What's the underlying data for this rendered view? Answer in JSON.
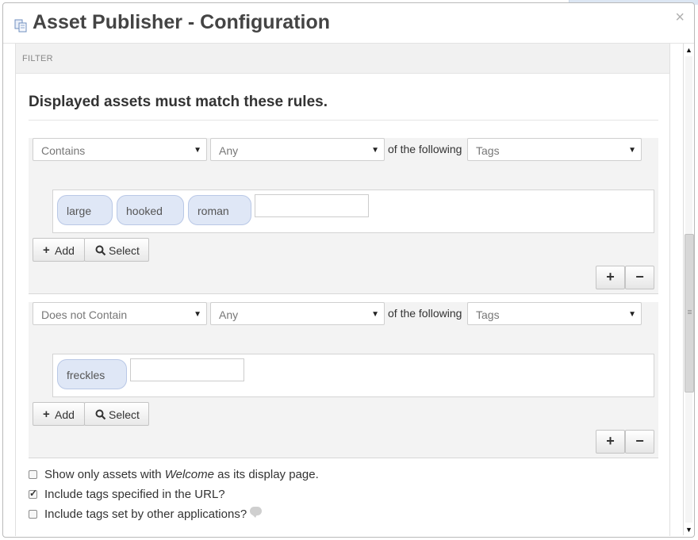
{
  "dialog": {
    "title": "Asset Publisher - Configuration",
    "close_symbol": "×",
    "icon": "document-pages-icon"
  },
  "filter": {
    "panel_label": "FILTER",
    "heading": "Displayed assets must match these rules."
  },
  "rules": [
    {
      "operator": "Contains",
      "match": "Any",
      "connector": "of the following",
      "type": "Tags",
      "tags": [
        "large",
        "hooked",
        "roman"
      ],
      "add_label": "Add",
      "select_label": "Select",
      "plus_symbol": "+",
      "minus_symbol": "−"
    },
    {
      "operator": "Does not Contain",
      "match": "Any",
      "connector": "of the following",
      "type": "Tags",
      "tags": [
        "freckles"
      ],
      "add_label": "Add",
      "select_label": "Select",
      "plus_symbol": "+",
      "minus_symbol": "−"
    }
  ],
  "options": {
    "show_only_prefix": "Show only assets with ",
    "show_only_page": "Welcome",
    "show_only_suffix": " as its display page.",
    "show_only_checked": false,
    "include_url_tags": "Include tags specified in the URL?",
    "include_url_tags_checked": true,
    "include_other_apps": "Include tags set by other applications?",
    "include_other_apps_checked": false
  },
  "colors": {
    "tag_bg": "#dfe7f6",
    "tag_border": "#b9c8e6",
    "panel_bg": "#f3f3f3"
  }
}
